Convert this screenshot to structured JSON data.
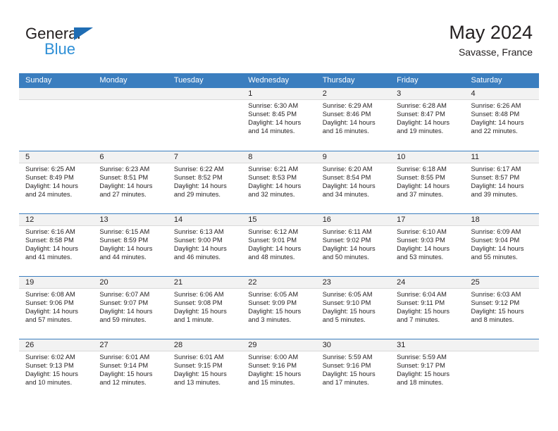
{
  "brand": {
    "name_part1": "General",
    "name_part2": "Blue",
    "triangle_color": "#1f6db4",
    "blue_text_color": "#2e8fd6"
  },
  "header": {
    "title": "May 2024",
    "location": "Savasse, France",
    "header_bg": "#3b7ebf",
    "daynum_bg": "#f2f2f2"
  },
  "weekdays": [
    "Sunday",
    "Monday",
    "Tuesday",
    "Wednesday",
    "Thursday",
    "Friday",
    "Saturday"
  ],
  "weeks": [
    [
      {
        "day": "",
        "sunrise": "",
        "sunset": "",
        "daylight_line1": "",
        "daylight_line2": ""
      },
      {
        "day": "",
        "sunrise": "",
        "sunset": "",
        "daylight_line1": "",
        "daylight_line2": ""
      },
      {
        "day": "",
        "sunrise": "",
        "sunset": "",
        "daylight_line1": "",
        "daylight_line2": ""
      },
      {
        "day": "1",
        "sunrise": "Sunrise: 6:30 AM",
        "sunset": "Sunset: 8:45 PM",
        "daylight_line1": "Daylight: 14 hours",
        "daylight_line2": "and 14 minutes."
      },
      {
        "day": "2",
        "sunrise": "Sunrise: 6:29 AM",
        "sunset": "Sunset: 8:46 PM",
        "daylight_line1": "Daylight: 14 hours",
        "daylight_line2": "and 16 minutes."
      },
      {
        "day": "3",
        "sunrise": "Sunrise: 6:28 AM",
        "sunset": "Sunset: 8:47 PM",
        "daylight_line1": "Daylight: 14 hours",
        "daylight_line2": "and 19 minutes."
      },
      {
        "day": "4",
        "sunrise": "Sunrise: 6:26 AM",
        "sunset": "Sunset: 8:48 PM",
        "daylight_line1": "Daylight: 14 hours",
        "daylight_line2": "and 22 minutes."
      }
    ],
    [
      {
        "day": "5",
        "sunrise": "Sunrise: 6:25 AM",
        "sunset": "Sunset: 8:49 PM",
        "daylight_line1": "Daylight: 14 hours",
        "daylight_line2": "and 24 minutes."
      },
      {
        "day": "6",
        "sunrise": "Sunrise: 6:23 AM",
        "sunset": "Sunset: 8:51 PM",
        "daylight_line1": "Daylight: 14 hours",
        "daylight_line2": "and 27 minutes."
      },
      {
        "day": "7",
        "sunrise": "Sunrise: 6:22 AM",
        "sunset": "Sunset: 8:52 PM",
        "daylight_line1": "Daylight: 14 hours",
        "daylight_line2": "and 29 minutes."
      },
      {
        "day": "8",
        "sunrise": "Sunrise: 6:21 AM",
        "sunset": "Sunset: 8:53 PM",
        "daylight_line1": "Daylight: 14 hours",
        "daylight_line2": "and 32 minutes."
      },
      {
        "day": "9",
        "sunrise": "Sunrise: 6:20 AM",
        "sunset": "Sunset: 8:54 PM",
        "daylight_line1": "Daylight: 14 hours",
        "daylight_line2": "and 34 minutes."
      },
      {
        "day": "10",
        "sunrise": "Sunrise: 6:18 AM",
        "sunset": "Sunset: 8:55 PM",
        "daylight_line1": "Daylight: 14 hours",
        "daylight_line2": "and 37 minutes."
      },
      {
        "day": "11",
        "sunrise": "Sunrise: 6:17 AM",
        "sunset": "Sunset: 8:57 PM",
        "daylight_line1": "Daylight: 14 hours",
        "daylight_line2": "and 39 minutes."
      }
    ],
    [
      {
        "day": "12",
        "sunrise": "Sunrise: 6:16 AM",
        "sunset": "Sunset: 8:58 PM",
        "daylight_line1": "Daylight: 14 hours",
        "daylight_line2": "and 41 minutes."
      },
      {
        "day": "13",
        "sunrise": "Sunrise: 6:15 AM",
        "sunset": "Sunset: 8:59 PM",
        "daylight_line1": "Daylight: 14 hours",
        "daylight_line2": "and 44 minutes."
      },
      {
        "day": "14",
        "sunrise": "Sunrise: 6:13 AM",
        "sunset": "Sunset: 9:00 PM",
        "daylight_line1": "Daylight: 14 hours",
        "daylight_line2": "and 46 minutes."
      },
      {
        "day": "15",
        "sunrise": "Sunrise: 6:12 AM",
        "sunset": "Sunset: 9:01 PM",
        "daylight_line1": "Daylight: 14 hours",
        "daylight_line2": "and 48 minutes."
      },
      {
        "day": "16",
        "sunrise": "Sunrise: 6:11 AM",
        "sunset": "Sunset: 9:02 PM",
        "daylight_line1": "Daylight: 14 hours",
        "daylight_line2": "and 50 minutes."
      },
      {
        "day": "17",
        "sunrise": "Sunrise: 6:10 AM",
        "sunset": "Sunset: 9:03 PM",
        "daylight_line1": "Daylight: 14 hours",
        "daylight_line2": "and 53 minutes."
      },
      {
        "day": "18",
        "sunrise": "Sunrise: 6:09 AM",
        "sunset": "Sunset: 9:04 PM",
        "daylight_line1": "Daylight: 14 hours",
        "daylight_line2": "and 55 minutes."
      }
    ],
    [
      {
        "day": "19",
        "sunrise": "Sunrise: 6:08 AM",
        "sunset": "Sunset: 9:06 PM",
        "daylight_line1": "Daylight: 14 hours",
        "daylight_line2": "and 57 minutes."
      },
      {
        "day": "20",
        "sunrise": "Sunrise: 6:07 AM",
        "sunset": "Sunset: 9:07 PM",
        "daylight_line1": "Daylight: 14 hours",
        "daylight_line2": "and 59 minutes."
      },
      {
        "day": "21",
        "sunrise": "Sunrise: 6:06 AM",
        "sunset": "Sunset: 9:08 PM",
        "daylight_line1": "Daylight: 15 hours",
        "daylight_line2": "and 1 minute."
      },
      {
        "day": "22",
        "sunrise": "Sunrise: 6:05 AM",
        "sunset": "Sunset: 9:09 PM",
        "daylight_line1": "Daylight: 15 hours",
        "daylight_line2": "and 3 minutes."
      },
      {
        "day": "23",
        "sunrise": "Sunrise: 6:05 AM",
        "sunset": "Sunset: 9:10 PM",
        "daylight_line1": "Daylight: 15 hours",
        "daylight_line2": "and 5 minutes."
      },
      {
        "day": "24",
        "sunrise": "Sunrise: 6:04 AM",
        "sunset": "Sunset: 9:11 PM",
        "daylight_line1": "Daylight: 15 hours",
        "daylight_line2": "and 7 minutes."
      },
      {
        "day": "25",
        "sunrise": "Sunrise: 6:03 AM",
        "sunset": "Sunset: 9:12 PM",
        "daylight_line1": "Daylight: 15 hours",
        "daylight_line2": "and 8 minutes."
      }
    ],
    [
      {
        "day": "26",
        "sunrise": "Sunrise: 6:02 AM",
        "sunset": "Sunset: 9:13 PM",
        "daylight_line1": "Daylight: 15 hours",
        "daylight_line2": "and 10 minutes."
      },
      {
        "day": "27",
        "sunrise": "Sunrise: 6:01 AM",
        "sunset": "Sunset: 9:14 PM",
        "daylight_line1": "Daylight: 15 hours",
        "daylight_line2": "and 12 minutes."
      },
      {
        "day": "28",
        "sunrise": "Sunrise: 6:01 AM",
        "sunset": "Sunset: 9:15 PM",
        "daylight_line1": "Daylight: 15 hours",
        "daylight_line2": "and 13 minutes."
      },
      {
        "day": "29",
        "sunrise": "Sunrise: 6:00 AM",
        "sunset": "Sunset: 9:16 PM",
        "daylight_line1": "Daylight: 15 hours",
        "daylight_line2": "and 15 minutes."
      },
      {
        "day": "30",
        "sunrise": "Sunrise: 5:59 AM",
        "sunset": "Sunset: 9:16 PM",
        "daylight_line1": "Daylight: 15 hours",
        "daylight_line2": "and 17 minutes."
      },
      {
        "day": "31",
        "sunrise": "Sunrise: 5:59 AM",
        "sunset": "Sunset: 9:17 PM",
        "daylight_line1": "Daylight: 15 hours",
        "daylight_line2": "and 18 minutes."
      },
      {
        "day": "",
        "sunrise": "",
        "sunset": "",
        "daylight_line1": "",
        "daylight_line2": ""
      }
    ]
  ]
}
